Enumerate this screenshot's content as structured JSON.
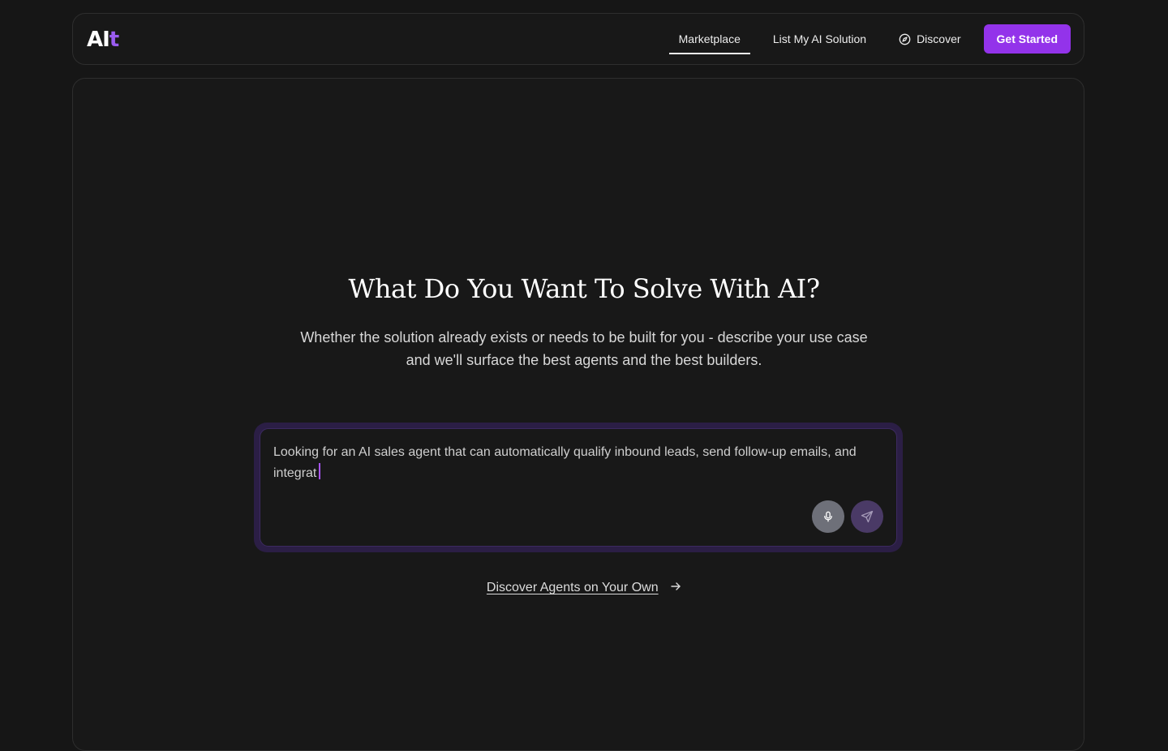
{
  "nav": {
    "logo_primary": "AI",
    "logo_accent": "t",
    "links": [
      {
        "label": "Marketplace",
        "active": true
      },
      {
        "label": "List My AI Solution",
        "active": false
      },
      {
        "label": "Discover",
        "active": false,
        "icon": "compass-icon"
      }
    ],
    "cta_label": "Get Started"
  },
  "hero": {
    "title": "What Do You Want To Solve With AI?",
    "subtitle": "Whether the solution already exists or needs to be built for you - describe your use case and we'll surface the best agents and the best builders."
  },
  "prompt": {
    "value": "Looking for an AI sales agent that can automatically qualify inbound leads, send follow-up emails, and integrat",
    "mic_icon": "microphone-icon",
    "send_icon": "send-icon"
  },
  "discover_link": {
    "label": "Discover Agents on Your Own",
    "icon": "arrow-right-icon"
  },
  "colors": {
    "background": "#161616",
    "accent": "#9333ea",
    "prompt_border": "#2b1e45"
  }
}
